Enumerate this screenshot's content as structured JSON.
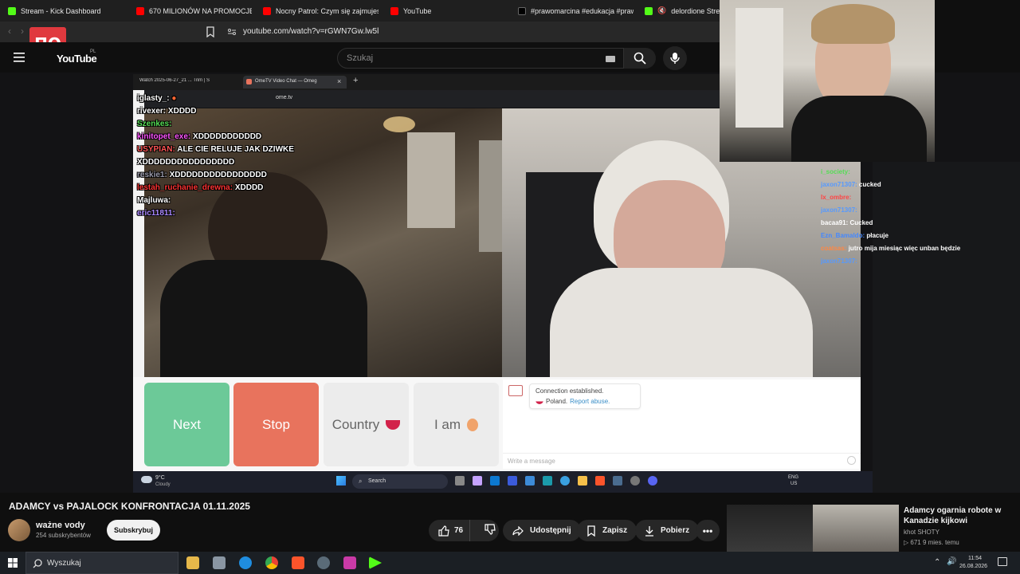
{
  "browser_tabs": [
    {
      "label": "Stream - Kick Dashboard",
      "color": "#53fc18"
    },
    {
      "label": "670 MILIONÓW NA PROMOCJĘ PO",
      "color": "#ff0000"
    },
    {
      "label": "Nocny Patrol: Czym się zajmujesz i",
      "color": "#ff0000"
    },
    {
      "label": "YouTube",
      "color": "#ff0000"
    },
    {
      "label": "#prawomarcina #edukacja #prawo",
      "color": "#000000"
    },
    {
      "label": "delordione Stream",
      "color": "#53fc18"
    }
  ],
  "address_url": "youtube.com/watch?v=rGWN7Gw.lw5l",
  "logo_text": "YouTube",
  "logo_region": "PL",
  "search_placeholder": "Szukaj",
  "inner_browser": {
    "tab1": "Watch 2025-06-27_21 ... Trim | S",
    "tab2": "OmeTV Video Chat — Omeg",
    "url": "ome.tv"
  },
  "stream_chat": [
    {
      "user": "iglasty_:",
      "msg": "",
      "color": "#ffffff"
    },
    {
      "user": "rivexer:",
      "msg": "XDDDD",
      "color": "#ffffff"
    },
    {
      "user": "Szenkes:",
      "msg": "",
      "color": "#55dd55"
    },
    {
      "user": "kinitopet_exe:",
      "msg": "XDDDDDDDDDDD",
      "color": "#ff55ff"
    },
    {
      "user": "USYPIAN:",
      "msg": "ALE CIE RELUJE JAK DZIWKE",
      "color": "#ff5555"
    },
    {
      "user": "",
      "msg": "XDDDDDDDDDDDDDDDD",
      "color": "#ffffff"
    },
    {
      "user": "reskie1:",
      "msg": "XDDDDDDDDDDDDDDDD",
      "color": "#8888aa"
    },
    {
      "user": "lestah_ruchanie_drewna:",
      "msg": "XDDDD",
      "color": "#ff3333"
    },
    {
      "user": "Majluwa:",
      "msg": "",
      "color": "#ffffff"
    },
    {
      "user": "eric11811:",
      "msg": "",
      "color": "#aa88ff"
    }
  ],
  "ometv": {
    "next": "Next",
    "stop": "Stop",
    "country": "Country",
    "i_am": "I am",
    "status_line1": "Connection established.",
    "status_line2": "Poland.",
    "report": "Report abuse.",
    "message_placeholder": "Write a message"
  },
  "inner_taskbar": {
    "weather_temp": "9°C",
    "weather_desc": "Cloudy",
    "search": "Search",
    "lang1": "ENG",
    "lang2": "US"
  },
  "kick_chat": [
    {
      "user": "i_society:",
      "msg": "",
      "color": "#55dd55"
    },
    {
      "user": "jaxon71307:",
      "msg": "cucked",
      "color": "#5599ff"
    },
    {
      "user": "lx_ombre:",
      "msg": "",
      "color": "#ff4444"
    },
    {
      "user": "jaxon71307:",
      "msg": "",
      "color": "#5599ff"
    },
    {
      "user": "bacaa91:",
      "msg": "Cucked",
      "color": "#ffffff"
    },
    {
      "user": "Ezn_Bamaldo:",
      "msg": "płacuje",
      "color": "#4488ff"
    },
    {
      "user": "coatsas:",
      "msg": "jutro mija miesiąc więc unban będzie",
      "color": "#ff8844"
    },
    {
      "user": "jaxon71307:",
      "msg": "",
      "color": "#5599ff"
    }
  ],
  "video_title": "ADAMCY vs PAJALOCK KONFRONTACJA 01.11.2025",
  "channel_name": "ważne vody",
  "subscribers": "254 subskrybentów",
  "subscribe_label": "Subskrybuj",
  "likes": "76",
  "share_label": "Udostępnij",
  "save_label": "Zapisz",
  "download_label": "Pobierz",
  "recommended": {
    "title_line1": "Adamcy ogarnia robote w",
    "title_line2": "Kanadzie kijkowi",
    "channel": "khot SHOTY",
    "meta": "▷ 671  9 mies. temu"
  },
  "win_search": "Wyszukaj",
  "clock_time": "11:54",
  "clock_date": "26.08.2026",
  "colors": {
    "next_btn": "#6cc998",
    "stop_btn": "#e8735d",
    "youtube_red": "#ff0000"
  }
}
